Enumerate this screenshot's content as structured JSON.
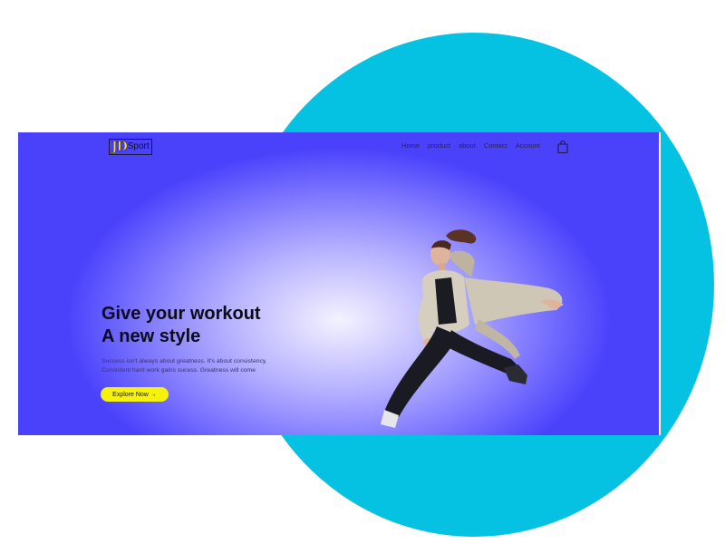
{
  "brand": {
    "logo_jd": "JD",
    "logo_sport": "Sport"
  },
  "nav": {
    "items": [
      {
        "label": "Home"
      },
      {
        "label": "product"
      },
      {
        "label": "about"
      },
      {
        "label": "Contact"
      },
      {
        "label": "Account"
      }
    ],
    "cart_icon": "shopping-bag-icon"
  },
  "hero": {
    "headline_line1": "Give your workout",
    "headline_line2": "A new style",
    "description_line1": "Success isn't always about greatness. It's about consistency.",
    "description_line2": "Consistent hard work gains sucess. Greatness will come",
    "cta_label": "Explore Now →"
  },
  "colors": {
    "circle": "#06c2e2",
    "hero_edge": "#4a42fb",
    "hero_center": "#f4f2ff",
    "cta": "#f6f20a",
    "logo_jd": "#f2d83a"
  }
}
